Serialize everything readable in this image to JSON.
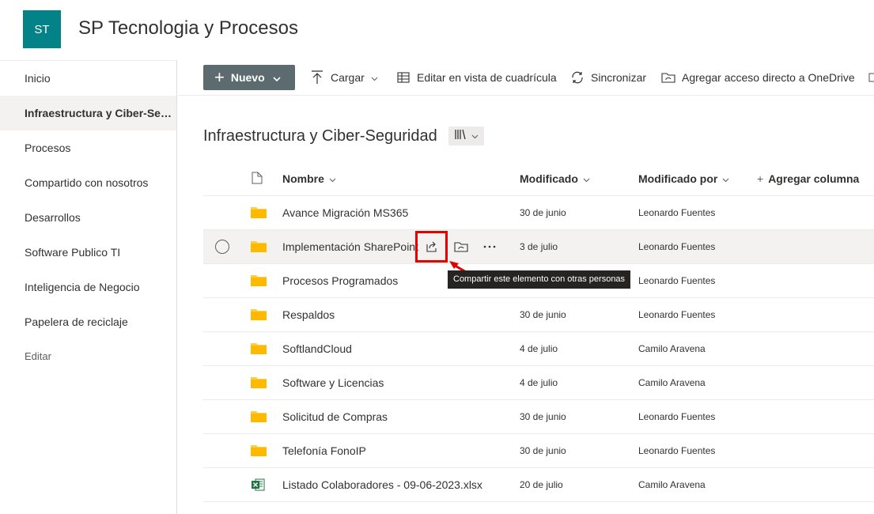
{
  "site": {
    "logo": "ST",
    "title": "SP Tecnologia y Procesos"
  },
  "nav": [
    {
      "label": "Inicio"
    },
    {
      "label": "Infraestructura y Ciber-Seguridad"
    },
    {
      "label": "Procesos"
    },
    {
      "label": "Compartido con nosotros"
    },
    {
      "label": "Desarrollos"
    },
    {
      "label": "Software Publico TI"
    },
    {
      "label": "Inteligencia de Negocio"
    },
    {
      "label": "Papelera de reciclaje"
    },
    {
      "label": "Editar"
    }
  ],
  "toolbar": {
    "new_label": "Nuevo",
    "upload_label": "Cargar",
    "grid_label": "Editar en vista de cuadrícula",
    "sync_label": "Sincronizar",
    "onedrive_label": "Agregar acceso directo a OneDrive"
  },
  "library": {
    "title": "Infraestructura y Ciber-Seguridad"
  },
  "columns": {
    "name": "Nombre",
    "modified": "Modificado",
    "modified_by": "Modificado por",
    "add_column": "Agregar columna"
  },
  "rows": [
    {
      "name": "Avance Migración MS365",
      "modified": "30 de junio",
      "modified_by": "Leonardo Fuentes",
      "type": "folder"
    },
    {
      "name": "Implementación SharePoint",
      "modified": "3 de julio",
      "modified_by": "Leonardo Fuentes",
      "type": "folder"
    },
    {
      "name": "Procesos Programados",
      "modified": "",
      "modified_by": "Leonardo Fuentes",
      "type": "folder"
    },
    {
      "name": "Respaldos",
      "modified": "30 de junio",
      "modified_by": "Leonardo Fuentes",
      "type": "folder"
    },
    {
      "name": "SoftlandCloud",
      "modified": "4 de julio",
      "modified_by": "Camilo Aravena",
      "type": "folder"
    },
    {
      "name": "Software y Licencias",
      "modified": "4 de julio",
      "modified_by": "Camilo Aravena",
      "type": "folder"
    },
    {
      "name": "Solicitud de Compras",
      "modified": "30 de junio",
      "modified_by": "Leonardo Fuentes",
      "type": "folder"
    },
    {
      "name": "Telefonía FonoIP",
      "modified": "30 de junio",
      "modified_by": "Leonardo Fuentes",
      "type": "folder"
    },
    {
      "name": "Listado Colaboradores - 09-06-2023.xlsx",
      "modified": "20 de julio",
      "modified_by": "Camilo Aravena",
      "type": "excel"
    }
  ],
  "tooltip": {
    "text": "Compartir este elemento con otras personas"
  },
  "colors": {
    "brand": "#038387",
    "folder": "#ffce3d",
    "highlight": "#e30000",
    "excel": "#217346"
  }
}
